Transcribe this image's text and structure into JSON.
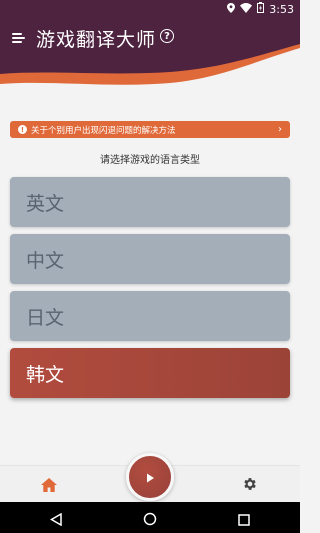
{
  "status_bar": {
    "time": "3:53",
    "icons": [
      "location-icon",
      "wifi-icon",
      "battery-icon"
    ]
  },
  "header": {
    "title": "游戏翻译大师",
    "menu_icon": "hamburger-menu-icon",
    "help_icon": "help-circle-icon",
    "help_glyph": "?",
    "colors": {
      "top": "#4e2340",
      "wave": "#e0693a"
    }
  },
  "notice": {
    "icon": "info-icon",
    "icon_glyph": "!",
    "text": "关于个别用户出现闪退问题的解决方法",
    "chevron": "›"
  },
  "prompt": "请选择游戏的语言类型",
  "languages": {
    "items": [
      {
        "label": "英文",
        "selected": false
      },
      {
        "label": "中文",
        "selected": false
      },
      {
        "label": "日文",
        "selected": false
      },
      {
        "label": "韩文",
        "selected": true
      }
    ],
    "colors": {
      "default": "#a3aeb9",
      "selected": "#a9473c"
    }
  },
  "bottom_nav": {
    "home_icon": "home-icon",
    "play_icon": "play-icon",
    "settings_icon": "gear-icon",
    "active_color": "#e0693a"
  },
  "system_nav": {
    "icons": [
      "back-icon",
      "home-circle-icon",
      "recents-icon"
    ]
  }
}
